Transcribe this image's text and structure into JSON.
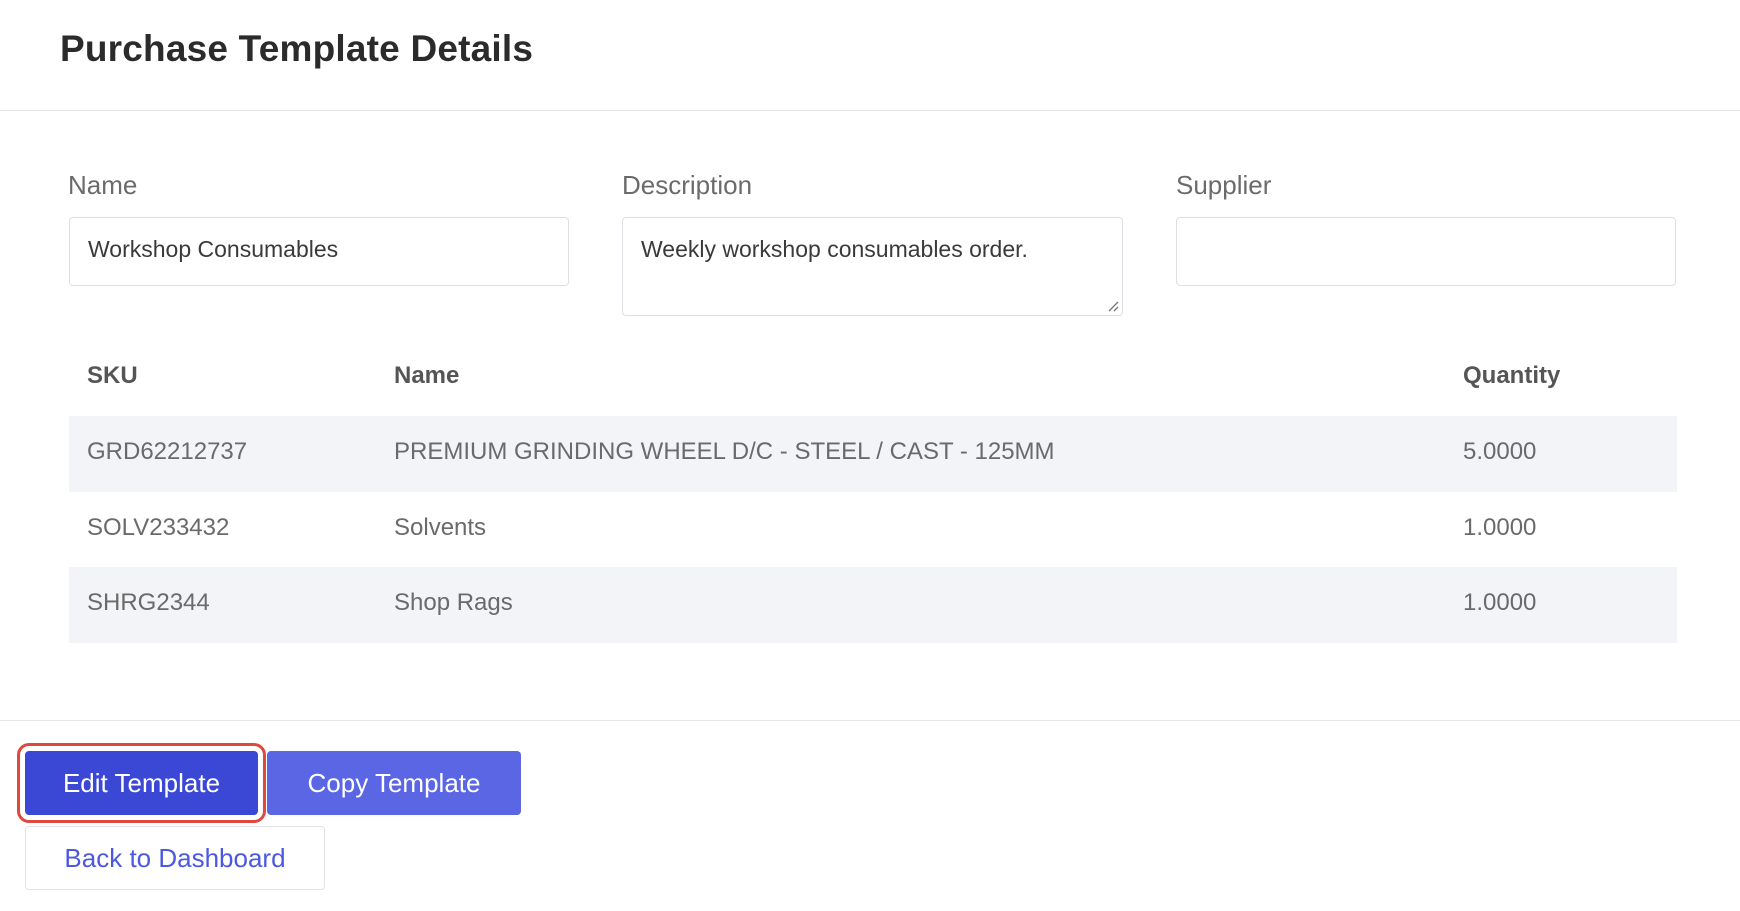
{
  "header": {
    "title": "Purchase Template Details"
  },
  "form": {
    "name_label": "Name",
    "name_value": "Workshop Consumables",
    "description_label": "Description",
    "description_value": "Weekly workshop consumables order.",
    "supplier_label": "Supplier",
    "supplier_value": ""
  },
  "table": {
    "columns": [
      "SKU",
      "Name",
      "Quantity"
    ],
    "rows": [
      {
        "sku": "GRD62212737",
        "name": "PREMIUM GRINDING WHEEL D/C - STEEL / CAST - 125MM",
        "quantity": "5.0000"
      },
      {
        "sku": "SOLV233432",
        "name": "Solvents",
        "quantity": "1.0000"
      },
      {
        "sku": "SHRG2344",
        "name": "Shop Rags",
        "quantity": "1.0000"
      }
    ]
  },
  "actions": {
    "edit_label": "Edit Template",
    "copy_label": "Copy Template",
    "back_label": "Back to Dashboard"
  },
  "colors": {
    "primary": "#3b48d6",
    "secondary_button": "#5a66e3",
    "highlight_outline": "#e0483e",
    "link": "#4c58e0",
    "row_shade": "#f3f4f7"
  }
}
